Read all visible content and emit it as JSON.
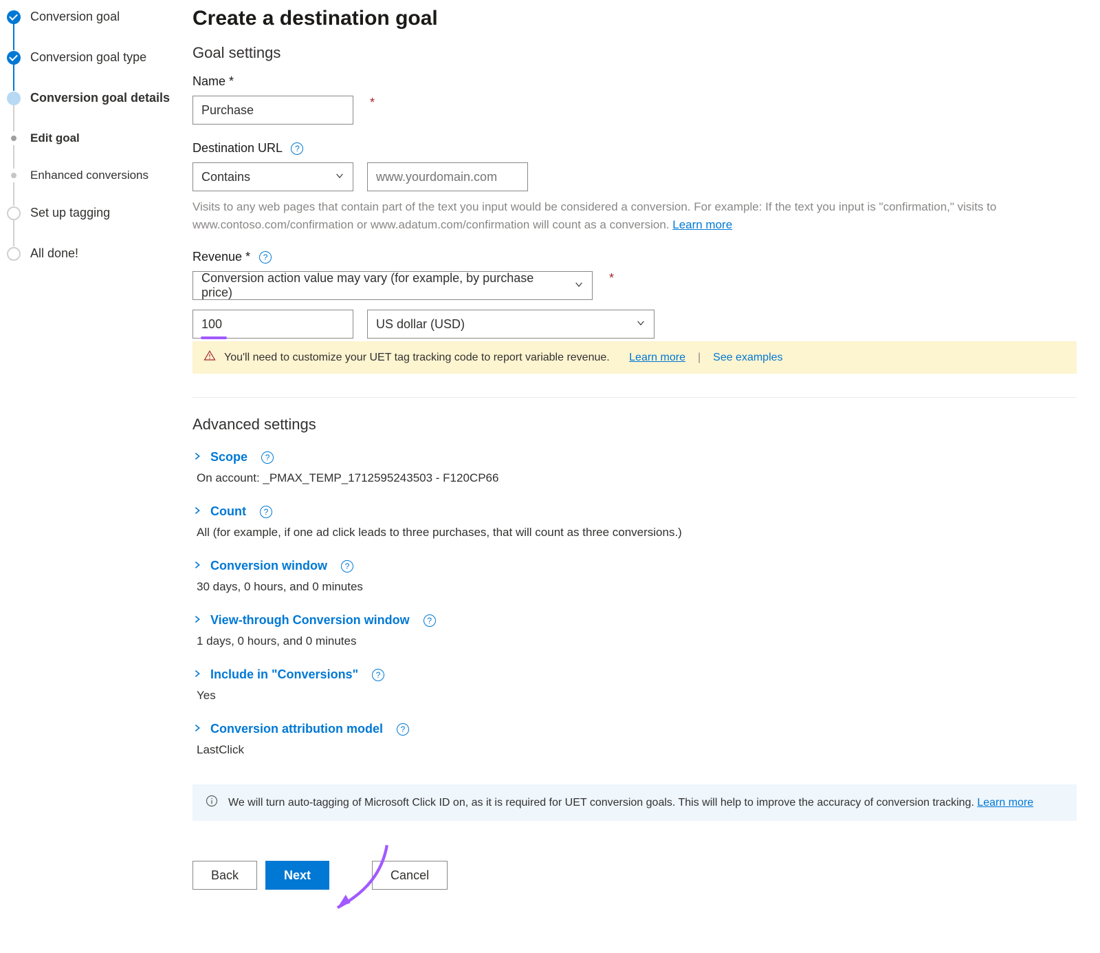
{
  "stepper": {
    "items": [
      {
        "label": "Conversion goal",
        "state": "completed"
      },
      {
        "label": "Conversion goal type",
        "state": "completed"
      },
      {
        "label": "Conversion goal details",
        "state": "current"
      },
      {
        "label": "Edit goal",
        "state": "sub-current"
      },
      {
        "label": "Enhanced conversions",
        "state": "sub"
      },
      {
        "label": "Set up tagging",
        "state": "future"
      },
      {
        "label": "All done!",
        "state": "future"
      }
    ]
  },
  "page": {
    "title": "Create a destination goal",
    "goal_settings_heading": "Goal settings"
  },
  "name_field": {
    "label": "Name *",
    "value": "Purchase"
  },
  "destination_url_field": {
    "label": "Destination URL",
    "match_type": "Contains",
    "url_placeholder": "www.yourdomain.com",
    "helper": "Visits to any web pages that contain part of the text you input would be considered a conversion. For example: If the text you input is \"confirmation,\" visits to www.contoso.com/confirmation or www.adatum.com/confirmation will count as a conversion.  ",
    "learn_more": "Learn more"
  },
  "revenue_field": {
    "label": "Revenue *",
    "type": "Conversion action value may vary (for example, by purchase price)",
    "value": "100",
    "currency": "US dollar (USD)"
  },
  "uet_alert": {
    "text": "You'll need to customize your UET tag tracking code to report variable revenue.",
    "learn_more": "Learn more",
    "see_examples": "See examples"
  },
  "advanced": {
    "heading": "Advanced settings",
    "scope": {
      "label": "Scope",
      "value": "On account: _PMAX_TEMP_1712595243503 - F120CP66"
    },
    "count": {
      "label": "Count",
      "value": "All (for example, if one ad click leads to three purchases, that will count as three conversions.)"
    },
    "conversion_window": {
      "label": "Conversion window",
      "value": "30 days, 0 hours, and 0 minutes"
    },
    "view_through": {
      "label": "View-through Conversion window",
      "value": "1 days, 0 hours, and 0 minutes"
    },
    "include_in": {
      "label": "Include in \"Conversions\"",
      "value": "Yes"
    },
    "attribution": {
      "label": "Conversion attribution model",
      "value": "LastClick"
    }
  },
  "auto_tag_info": {
    "text": "We will turn auto-tagging of Microsoft Click ID on, as it is required for UET conversion goals. This will help to improve the accuracy of conversion tracking.  ",
    "learn_more": "Learn more"
  },
  "footer": {
    "back": "Back",
    "next": "Next",
    "cancel": "Cancel"
  }
}
